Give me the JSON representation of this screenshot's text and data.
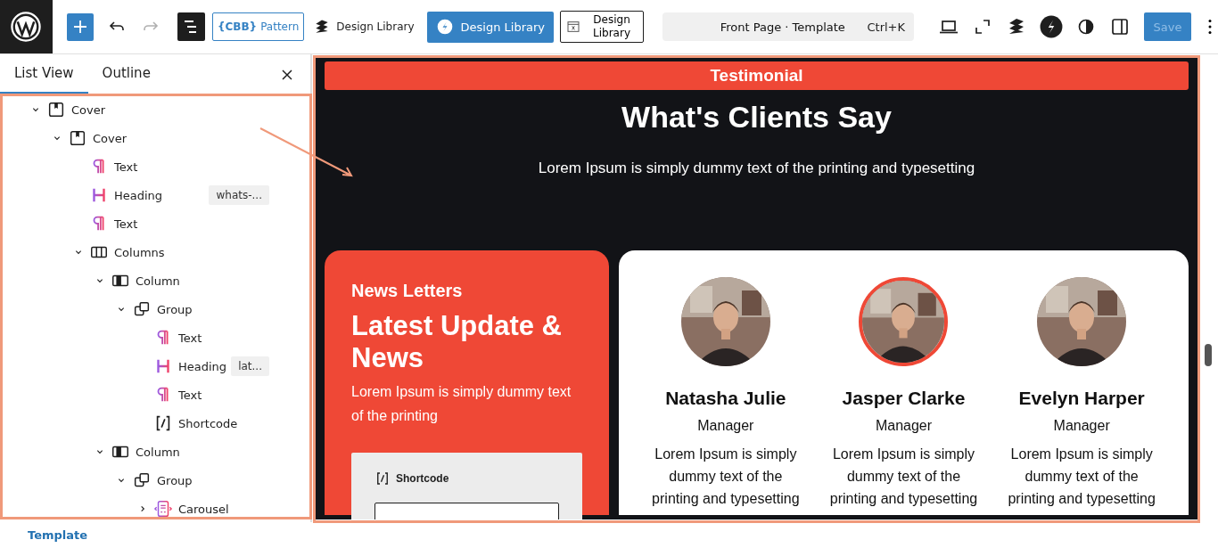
{
  "toolbar": [
    {
      "kind": "logo"
    },
    {
      "kind": "add"
    },
    {
      "kind": "undo",
      "disabled": false
    },
    {
      "kind": "redo",
      "disabled": true
    },
    {
      "kind": "list-view",
      "pressed": true
    },
    {
      "kind": "pattern",
      "logo_text": "{CBB}",
      "label": "Pattern"
    },
    {
      "kind": "library-link",
      "label": "Design Library"
    },
    {
      "kind": "library-primary",
      "label": "Design Library"
    },
    {
      "kind": "library-outline",
      "label": "Design Library"
    },
    {
      "kind": "command",
      "title": "Front Page · Template",
      "shortcut": "Ctrl+K"
    },
    {
      "kind": "device"
    },
    {
      "kind": "fullscreen"
    },
    {
      "kind": "stackable"
    },
    {
      "kind": "s-circle"
    },
    {
      "kind": "styles"
    },
    {
      "kind": "settings"
    },
    {
      "kind": "save",
      "label": "Save",
      "disabled": true
    },
    {
      "kind": "more"
    }
  ],
  "sidebar": {
    "tabs": [
      {
        "label": "List View",
        "selected": true
      },
      {
        "label": "Outline",
        "selected": false
      }
    ],
    "tree": [
      {
        "kind": "cover",
        "label": "Cover",
        "expanded": true,
        "children": [
          {
            "kind": "cover",
            "label": "Cover",
            "expanded": true,
            "children": [
              {
                "kind": "text",
                "label": "Text"
              },
              {
                "kind": "heading",
                "label": "Heading",
                "badge": "whats-..."
              },
              {
                "kind": "text",
                "label": "Text"
              },
              {
                "kind": "columns",
                "label": "Columns",
                "expanded": true,
                "children": [
                  {
                    "kind": "column",
                    "label": "Column",
                    "expanded": true,
                    "children": [
                      {
                        "kind": "group",
                        "label": "Group",
                        "expanded": true,
                        "children": [
                          {
                            "kind": "text",
                            "label": "Text"
                          },
                          {
                            "kind": "heading",
                            "label": "Heading",
                            "badge": "lat..."
                          },
                          {
                            "kind": "text",
                            "label": "Text"
                          },
                          {
                            "kind": "shortcode",
                            "label": "Shortcode"
                          }
                        ]
                      }
                    ]
                  },
                  {
                    "kind": "column",
                    "label": "Column",
                    "expanded": true,
                    "children": [
                      {
                        "kind": "group",
                        "label": "Group",
                        "expanded": true,
                        "children": [
                          {
                            "kind": "carousel",
                            "label": "Carousel",
                            "expanded": false
                          }
                        ]
                      }
                    ]
                  }
                ]
              }
            ]
          }
        ]
      }
    ]
  },
  "breadcrumb": "Template",
  "canvas": {
    "banner": "Testimonial",
    "heading": "What's Clients Say",
    "subtitle": "Lorem Ipsum is simply dummy text of the printing and typesetting",
    "news": {
      "eyebrow": "News Letters",
      "title": "Latest Update & News",
      "text": "Lorem Ipsum is simply dummy text of the printing",
      "shortcode_label": "Shortcode"
    },
    "testimonials": [
      {
        "name": "Natasha Julie",
        "role": "Manager",
        "text": "Lorem Ipsum is simply dummy text of the printing and typesetting",
        "highlighted": false
      },
      {
        "name": "Jasper Clarke",
        "role": "Manager",
        "text": "Lorem Ipsum is simply dummy text of the printing and typesetting",
        "highlighted": true
      },
      {
        "name": "Evelyn Harper",
        "role": "Manager",
        "text": "Lorem Ipsum is simply dummy text of the printing and typesetting",
        "highlighted": false
      }
    ]
  }
}
